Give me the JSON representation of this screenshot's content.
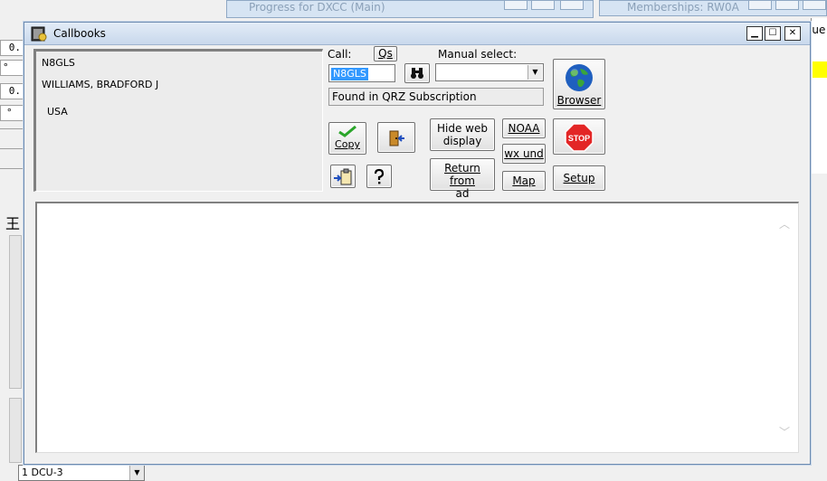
{
  "background": {
    "left_values": [
      "0.",
      "°",
      "0.",
      "°"
    ],
    "kanji": "王",
    "bottom_select": "1 DCU-3",
    "progress_window_title": "Progress for DXCC (Main)",
    "memberships_window_title": "Memberships: RW0A",
    "right_partial_text": "lue"
  },
  "window": {
    "title": "Callbooks"
  },
  "info": {
    "callsign": "N8GLS",
    "name": "WILLIAMS, BRADFORD J",
    "country": "USA"
  },
  "controls": {
    "call_label": "Call:",
    "qs_button": "Qs",
    "call_value": "N8GLS",
    "manual_select_label": "Manual select:",
    "manual_select_value": "",
    "found_text": "Found in QRZ Subscription",
    "browser_button": "Browser",
    "copy_button": "Copy",
    "hide_web_line1": "Hide web",
    "hide_web_line2": "display",
    "return_line1": "Return from",
    "return_line2": "ad",
    "noaa_button": "NOAA",
    "wx_button": "wx und",
    "map_button": "Map",
    "setup_button": "Setup"
  },
  "colors": {
    "title_gradient_top": "#e3ecf7",
    "title_gradient_bottom": "#c8d8ec",
    "selection": "#3399ff",
    "stop_red": "#e32626",
    "globe_blue": "#1f5fbf",
    "copy_check_green": "#2aa52a"
  },
  "icons": {
    "window": "callbook-icon",
    "search": "binoculars-icon",
    "exit": "door-exit-icon",
    "import": "clipboard-import-icon",
    "help": "question-icon",
    "browser": "globe-icon",
    "stop": "stop-sign-icon"
  }
}
